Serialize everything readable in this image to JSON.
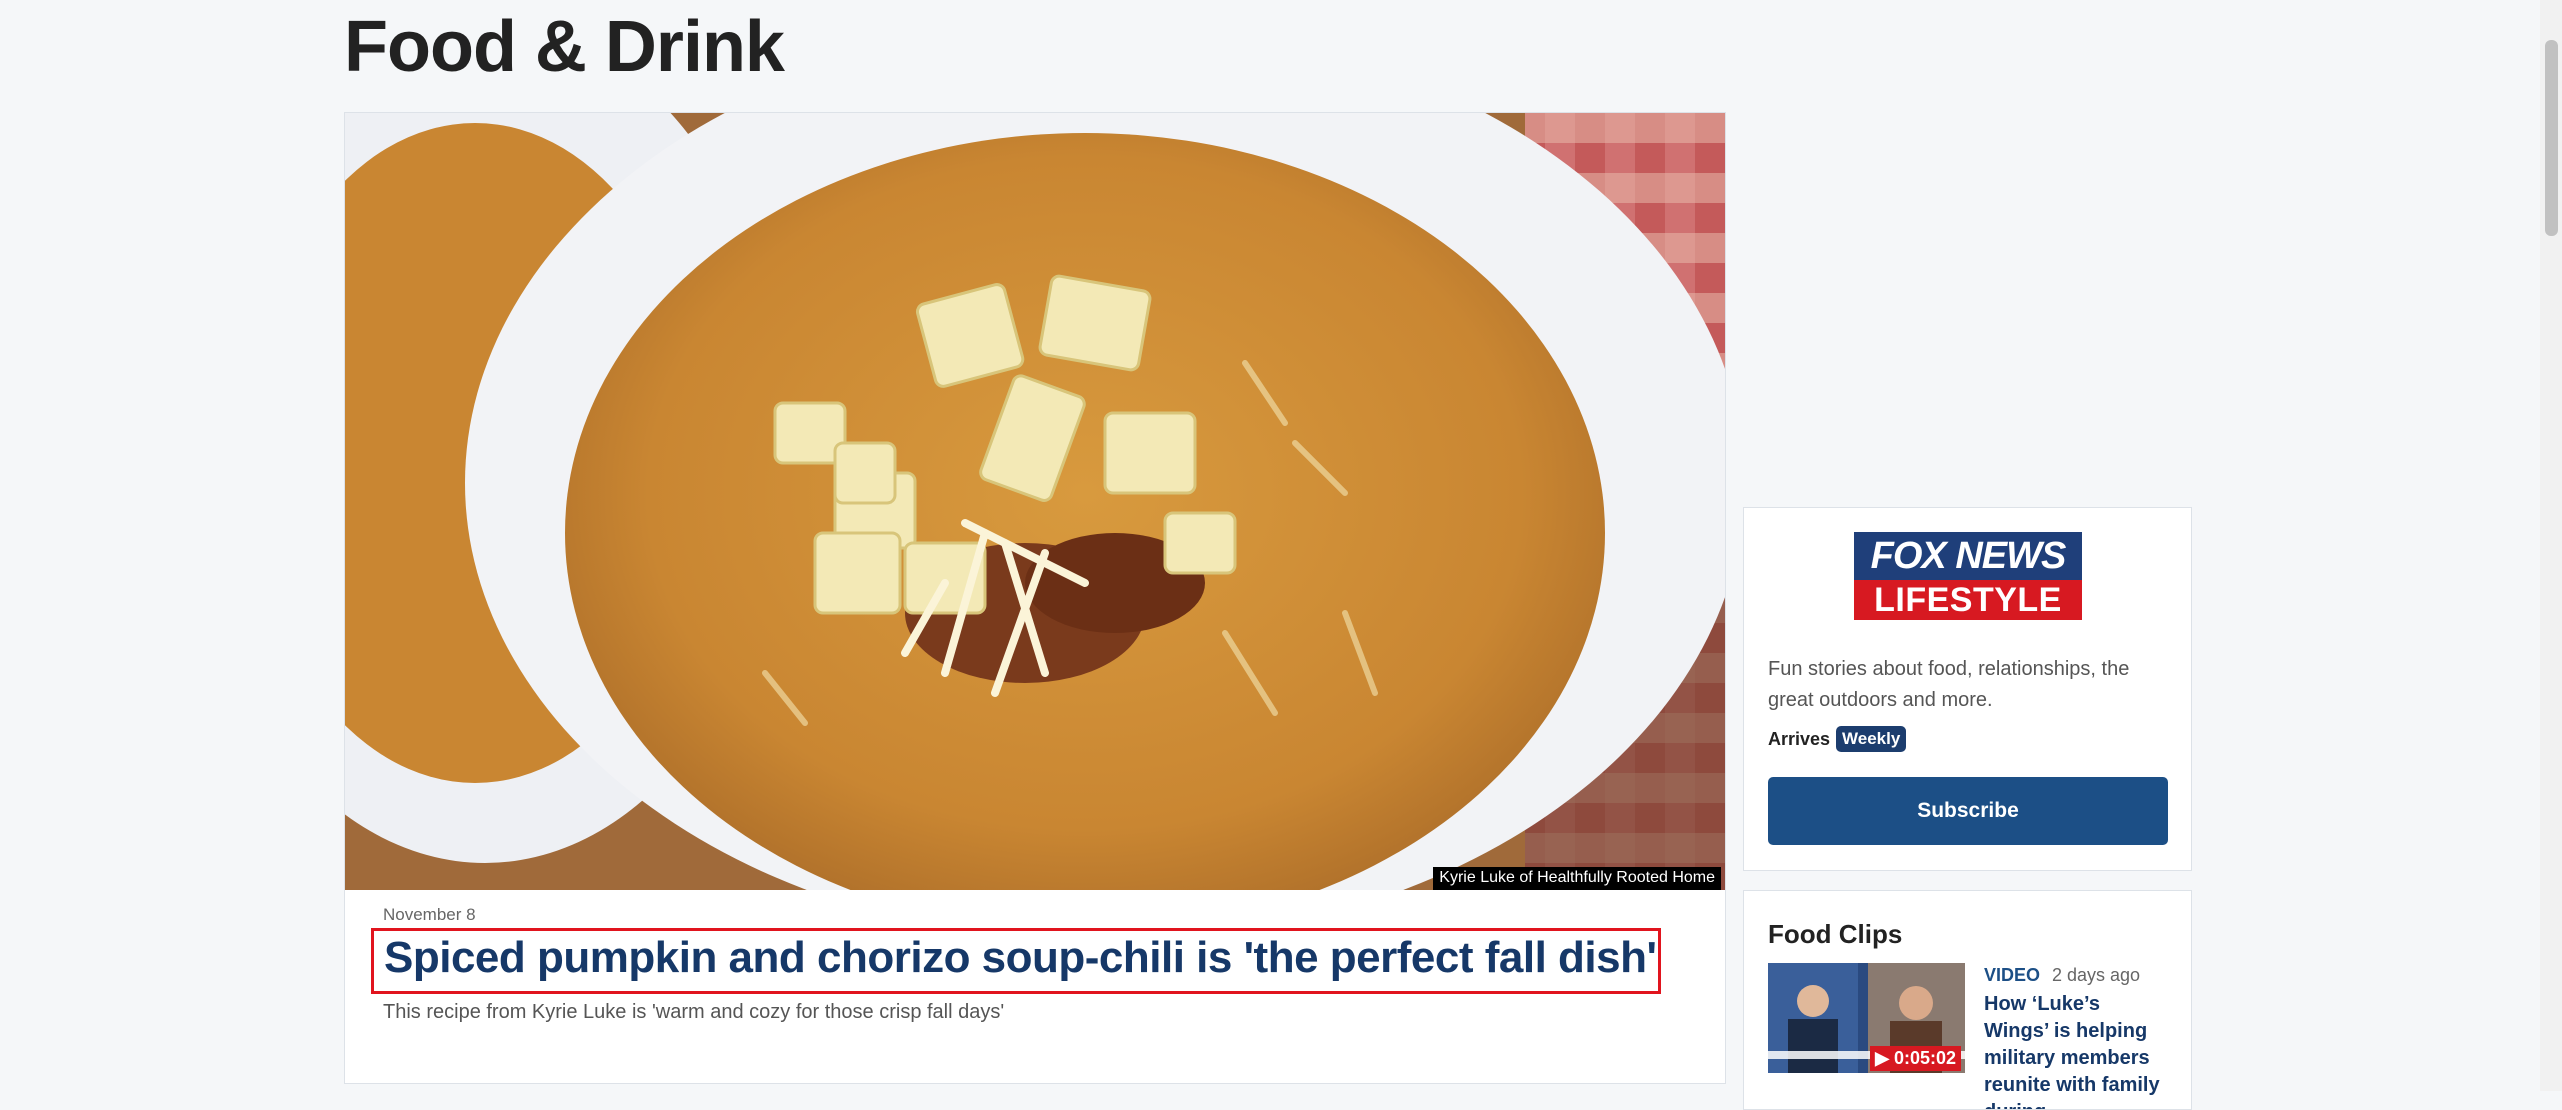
{
  "page": {
    "title": "Food & Drink"
  },
  "hero": {
    "credit": "Kyrie Luke of Healthfully Rooted Home",
    "date": "November 8",
    "headline": "Spiced pumpkin and chorizo soup-chili is 'the perfect fall dish'",
    "dek": "This recipe from Kyrie Luke is 'warm and cozy for those crisp fall days'"
  },
  "newsletter": {
    "logo_top": "FOX NEWS",
    "logo_bottom": "LIFESTYLE",
    "description": "Fun stories about food, relationships, the great outdoors and more.",
    "arrives_label": "Arrives",
    "frequency": "Weekly",
    "subscribe_label": "Subscribe"
  },
  "clips": {
    "title": "Food Clips",
    "items": [
      {
        "kicker": "VIDEO",
        "time": "2 days ago",
        "title": "How ‘Luke’s Wings’ is helping military members reunite with family during",
        "duration": "0:05:02"
      }
    ]
  },
  "colors": {
    "headline": "#163868",
    "accent_red": "#e1141e",
    "button": "#1c4f86"
  },
  "icons": [
    "play-icon"
  ]
}
